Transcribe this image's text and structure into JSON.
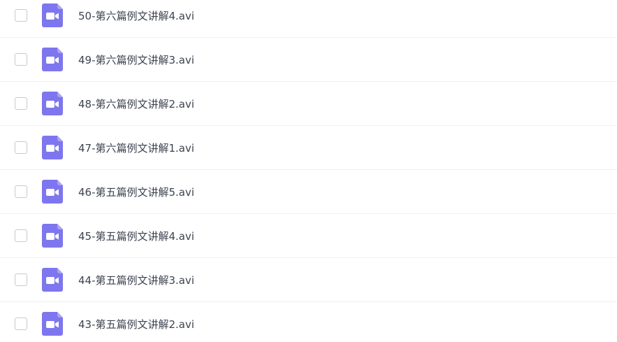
{
  "colors": {
    "icon": "#7e76ee",
    "text": "#3d4350",
    "divider": "#f0f0f2",
    "checkbox_border": "#c8cad0"
  },
  "files": [
    {
      "name": "50-第六篇例文讲解4.avi",
      "icon": "video-file-icon",
      "checked": false
    },
    {
      "name": "49-第六篇例文讲解3.avi",
      "icon": "video-file-icon",
      "checked": false
    },
    {
      "name": "48-第六篇例文讲解2.avi",
      "icon": "video-file-icon",
      "checked": false
    },
    {
      "name": "47-第六篇例文讲解1.avi",
      "icon": "video-file-icon",
      "checked": false
    },
    {
      "name": "46-第五篇例文讲解5.avi",
      "icon": "video-file-icon",
      "checked": false
    },
    {
      "name": "45-第五篇例文讲解4.avi",
      "icon": "video-file-icon",
      "checked": false
    },
    {
      "name": "44-第五篇例文讲解3.avi",
      "icon": "video-file-icon",
      "checked": false
    },
    {
      "name": "43-第五篇例文讲解2.avi",
      "icon": "video-file-icon",
      "checked": false
    }
  ]
}
